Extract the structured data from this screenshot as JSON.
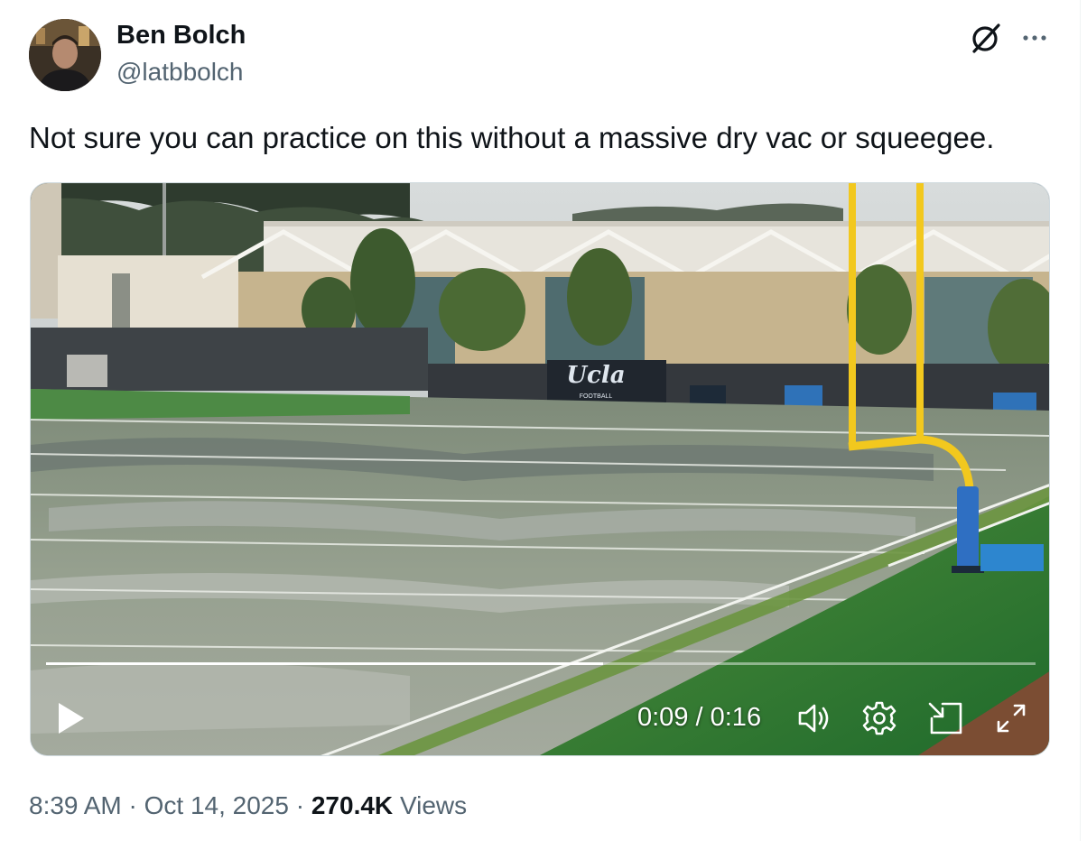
{
  "author": {
    "name": "Ben Bolch",
    "handle": "@latbbolch"
  },
  "tweet": {
    "text": "Not sure you can practice on this without a massive dry vac or squeegee."
  },
  "video": {
    "current_time": "0:09",
    "separator": " / ",
    "duration": "0:16",
    "progress_fraction": 0.5625,
    "signage": {
      "primary": "Ucla",
      "secondary": "FOOTBALL"
    }
  },
  "meta": {
    "time": "8:39 AM",
    "dot": " · ",
    "date": "Oct 14, 2025",
    "views_count": "270.4K",
    "views_label": "Views"
  },
  "icons": {
    "grok": "grok-icon",
    "more": "more-icon",
    "play": "play-icon",
    "volume": "volume-icon",
    "settings": "settings-icon",
    "dock": "dock-icon",
    "fullscreen": "fullscreen-icon"
  },
  "colors": {
    "text_primary": "#0f1419",
    "text_secondary": "#536471",
    "goalpost": "#f2c81e",
    "turf": "#2f7a33"
  }
}
